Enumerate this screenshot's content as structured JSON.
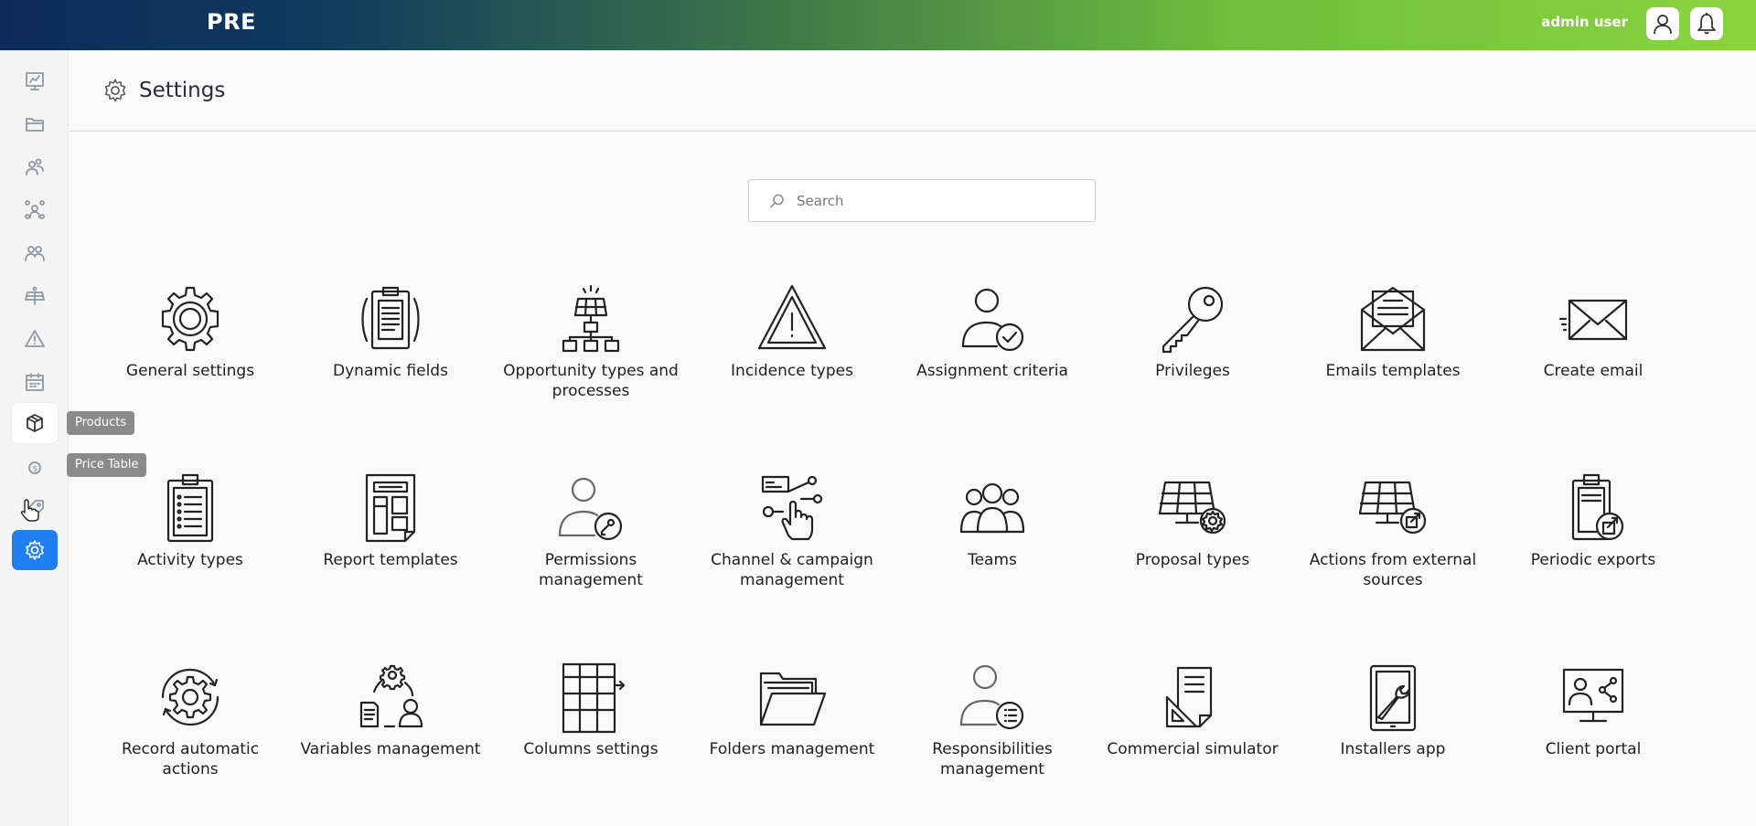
{
  "app": {
    "brand": "PRE",
    "user_name": "admin user"
  },
  "sidebar": {
    "items": [
      {
        "icon": "dashboard-icon"
      },
      {
        "icon": "folder-icon"
      },
      {
        "icon": "contacts-icon"
      },
      {
        "icon": "network-icon"
      },
      {
        "icon": "groups-icon"
      },
      {
        "icon": "solar-panel-icon"
      },
      {
        "icon": "warning-icon"
      },
      {
        "icon": "calendar-icon"
      },
      {
        "icon": "box-icon"
      },
      {
        "icon": "price-icon"
      },
      {
        "icon": "tag-icon"
      },
      {
        "icon": "gear-icon"
      }
    ],
    "tooltip_products": "Products",
    "tooltip_price_table": "Price Table"
  },
  "header": {
    "title": "Settings"
  },
  "search": {
    "placeholder": "Search"
  },
  "tiles": [
    {
      "label": "General settings",
      "icon": "gear-icon"
    },
    {
      "label": "Dynamic fields",
      "icon": "clipboard-icon"
    },
    {
      "label": "Opportunity types and processes",
      "icon": "solar-hierarchy-icon"
    },
    {
      "label": "Incidence types",
      "icon": "warning-triangle-icon"
    },
    {
      "label": "Assignment criteria",
      "icon": "user-check-icon"
    },
    {
      "label": "Privileges",
      "icon": "key-icon"
    },
    {
      "label": "Emails templates",
      "icon": "open-envelope-icon"
    },
    {
      "label": "Create email",
      "icon": "send-envelope-icon"
    },
    {
      "label": "Activity types",
      "icon": "checklist-icon"
    },
    {
      "label": "Report templates",
      "icon": "report-icon"
    },
    {
      "label": "Permissions management",
      "icon": "user-key-icon"
    },
    {
      "label": "Channel & campaign management",
      "icon": "touch-channel-icon"
    },
    {
      "label": "Teams",
      "icon": "team-icon"
    },
    {
      "label": "Proposal types",
      "icon": "solar-gear-icon"
    },
    {
      "label": "Actions from external sources",
      "icon": "solar-external-icon"
    },
    {
      "label": "Periodic exports",
      "icon": "clipboard-export-icon"
    },
    {
      "label": "Record automatic actions",
      "icon": "gear-cycle-icon"
    },
    {
      "label": "Variables management",
      "icon": "variables-icon"
    },
    {
      "label": "Columns settings",
      "icon": "columns-icon"
    },
    {
      "label": "Folders management",
      "icon": "open-folder-icon"
    },
    {
      "label": "Responsibilities management",
      "icon": "user-list-icon"
    },
    {
      "label": "Commercial simulator",
      "icon": "simulator-icon"
    },
    {
      "label": "Installers app",
      "icon": "tablet-tools-icon"
    },
    {
      "label": "Client portal",
      "icon": "portal-share-icon"
    }
  ]
}
